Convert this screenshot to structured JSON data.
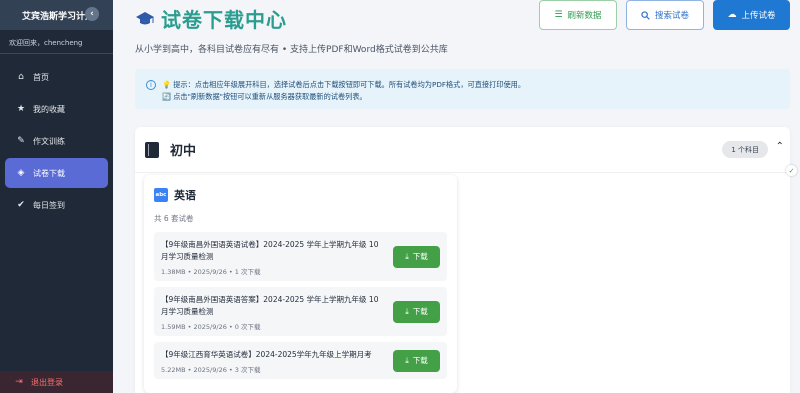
{
  "sidebar": {
    "app_title": "艾宾浩斯学习计划",
    "toggle_icon": "chevron-left-icon",
    "welcome": "欢迎回来，chencheng",
    "items": [
      {
        "label": "首页",
        "icon": "home-icon",
        "active": false
      },
      {
        "label": "我的收藏",
        "icon": "star-icon",
        "active": false
      },
      {
        "label": "作文训练",
        "icon": "pencil-icon",
        "active": false
      },
      {
        "label": "试卷下载",
        "icon": "layers-icon",
        "active": true
      },
      {
        "label": "每日签到",
        "icon": "check-circle-icon",
        "active": false
      }
    ],
    "logout_label": "退出登录"
  },
  "header": {
    "title": "试卷下载中心",
    "subtitle": "从小学到高中，各科目试卷应有尽有 • 支持上传PDF和Word格式试卷到公共库",
    "refresh_label": "刷新数据",
    "search_label": "搜索试卷",
    "upload_label": "上传试卷"
  },
  "tip": {
    "line1": "💡 提示：点击相应年级展开科目，选择试卷后点击下载按钮即可下载。所有试卷均为PDF格式，可直接打印使用。",
    "line2": "🔄 点击\"刷新数据\"按钮可以重新从服务器获取最新的试卷列表。"
  },
  "section": {
    "title": "初中",
    "count_badge": "1 个科目"
  },
  "subject": {
    "icon_text": "abc",
    "name": "英语",
    "count": "共 6 套试卷",
    "papers": [
      {
        "title": "【9年级南昌外国语英语试卷】2024-2025 学年上学期九年级 10 月学习质量检测",
        "meta": "1.38MB • 2025/9/26 • 1 次下载",
        "button": "下载"
      },
      {
        "title": "【9年级南昌外国语英语答案】2024-2025 学年上学期九年级 10 月学习质量检测",
        "meta": "1.59MB • 2025/9/26 • 0 次下载",
        "button": "下载"
      },
      {
        "title": "【9年级江西育华英语试卷】2024-2025学年九年级上学期月考",
        "meta": "5.22MB • 2025/9/26 • 3 次下载",
        "button": "下载"
      }
    ]
  },
  "colors": {
    "sidebar_bg": "#1f2937",
    "active_item": "#5b6bd6",
    "title_teal": "#2a9d8f",
    "download_green": "#43a047",
    "upload_blue": "#1f78d1"
  }
}
